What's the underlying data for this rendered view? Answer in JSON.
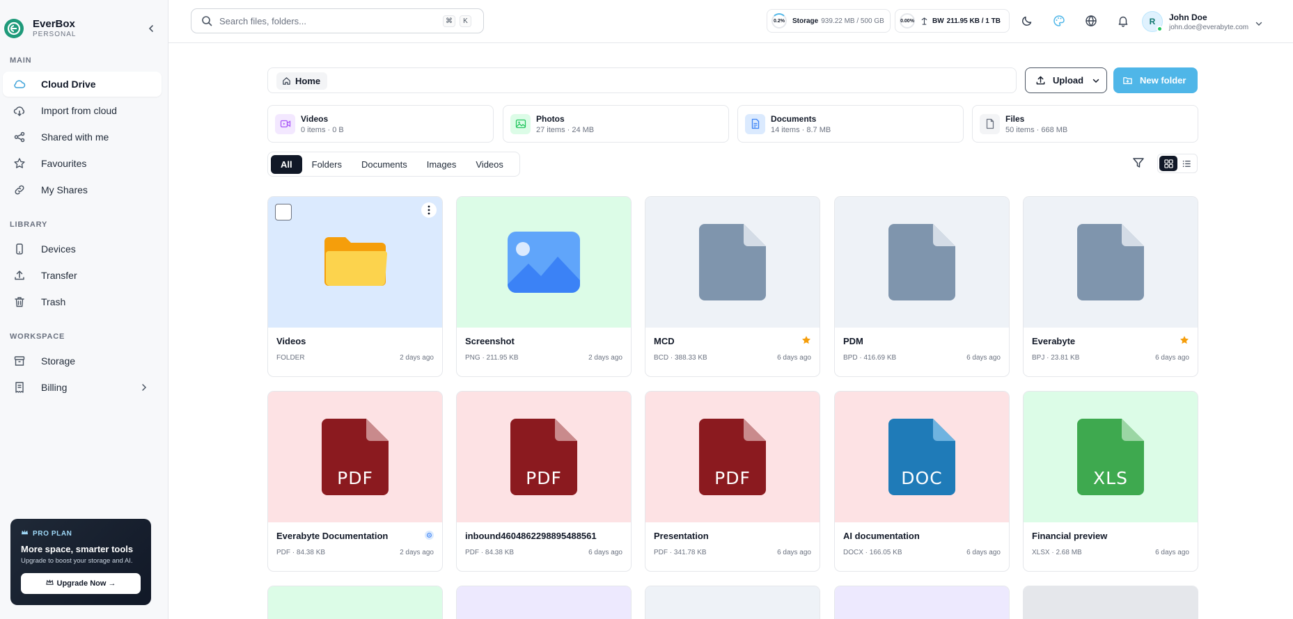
{
  "app": {
    "name": "EverBox",
    "plan_label": "PERSONAL"
  },
  "sidebar": {
    "sections": {
      "main": "MAIN",
      "library": "LIBRARY",
      "workspace": "WORKSPACE"
    },
    "main_items": [
      {
        "label": "Cloud Drive",
        "icon": "cloud-icon",
        "active": true
      },
      {
        "label": "Import from cloud",
        "icon": "cloud-import-icon"
      },
      {
        "label": "Shared with me",
        "icon": "share-icon"
      },
      {
        "label": "Favourites",
        "icon": "star-icon"
      },
      {
        "label": "My Shares",
        "icon": "link-icon"
      }
    ],
    "library_items": [
      {
        "label": "Devices",
        "icon": "device-icon"
      },
      {
        "label": "Transfer",
        "icon": "upload-icon"
      },
      {
        "label": "Trash",
        "icon": "trash-icon"
      }
    ],
    "workspace_items": [
      {
        "label": "Storage",
        "icon": "archive-icon"
      },
      {
        "label": "Billing",
        "icon": "receipt-icon"
      }
    ],
    "promo": {
      "tag": "PRO PLAN",
      "title": "More space, smarter tools",
      "subtitle": "Upgrade to boost your storage and AI.",
      "button": "Upgrade Now →"
    }
  },
  "topbar": {
    "search_placeholder": "Search files, folders...",
    "shortcut_keys": [
      "⌘",
      "K"
    ],
    "storage": {
      "percent": "0.2%",
      "label": "Storage",
      "value": "939.22 MB / 500 GB"
    },
    "bandwidth": {
      "percent": "0.00%",
      "label": "BW",
      "value": "211.95 KB / 1 TB"
    },
    "user": {
      "initial": "R",
      "name": "John Doe",
      "email": "john.doe@everabyte.com"
    }
  },
  "main": {
    "breadcrumb": "Home",
    "upload_label": "Upload",
    "new_folder_label": "New folder",
    "categories": [
      {
        "title": "Videos",
        "sub": "0 items · 0 B",
        "color": "#a855f7",
        "bg": "#f3e8ff",
        "icon": "video-icon"
      },
      {
        "title": "Photos",
        "sub": "27 items · 24 MB",
        "color": "#22c55e",
        "bg": "#dcfce7",
        "icon": "image-icon"
      },
      {
        "title": "Documents",
        "sub": "14 items · 8.7 MB",
        "color": "#3b82f6",
        "bg": "#dbeafe",
        "icon": "document-icon"
      },
      {
        "title": "Files",
        "sub": "50 items · 668 MB",
        "color": "#6b7280",
        "bg": "#f3f4f6",
        "icon": "file-icon"
      }
    ],
    "filter_tabs": [
      "All",
      "Folders",
      "Documents",
      "Images",
      "Videos"
    ],
    "files": [
      {
        "name": "Videos",
        "sub": "FOLDER",
        "date": "2 days ago",
        "kind": "folder",
        "bg": "#dbeafe"
      },
      {
        "name": "Screenshot",
        "sub": "PNG · 211.95 KB",
        "date": "2 days ago",
        "kind": "image",
        "bg": "#dcfce7"
      },
      {
        "name": "MCD",
        "sub": "BCD · 388.33 KB",
        "date": "6 days ago",
        "kind": "generic",
        "bg": "#eef2f7",
        "starred": true
      },
      {
        "name": "PDM",
        "sub": "BPD · 416.69 KB",
        "date": "6 days ago",
        "kind": "generic",
        "bg": "#eef2f7"
      },
      {
        "name": "Everabyte",
        "sub": "BPJ · 23.81 KB",
        "date": "6 days ago",
        "kind": "generic",
        "bg": "#eef2f7",
        "starred": true
      },
      {
        "name": "Everabyte Documentation",
        "sub": "PDF · 84.38 KB",
        "date": "2 days ago",
        "kind": "pdf",
        "label": "PDF",
        "bg": "#fde2e4",
        "shared": true
      },
      {
        "name": "inbound4604862298895488561",
        "sub": "PDF · 84.38 KB",
        "date": "6 days ago",
        "kind": "pdf",
        "label": "PDF",
        "bg": "#fde2e4"
      },
      {
        "name": "Presentation",
        "sub": "PDF · 341.78 KB",
        "date": "6 days ago",
        "kind": "pdf",
        "label": "PDF",
        "bg": "#fde2e4"
      },
      {
        "name": "AI documentation",
        "sub": "DOCX · 166.05 KB",
        "date": "6 days ago",
        "kind": "doc",
        "label": "DOC",
        "bg": "#fde2e4"
      },
      {
        "name": "Financial preview",
        "sub": "XLSX · 2.68 MB",
        "date": "6 days ago",
        "kind": "xls",
        "label": "XLS",
        "bg": "#dcfce7"
      }
    ],
    "partial_row_bgs": [
      "#dcfce7",
      "#ede9fe",
      "#eef2f7",
      "#ede9fe",
      "#e5e7eb"
    ]
  }
}
